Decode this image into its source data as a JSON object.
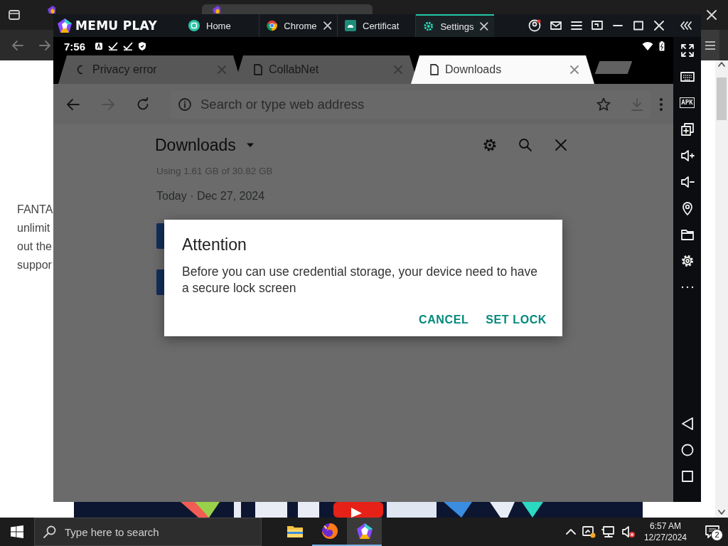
{
  "desktop_browser": {
    "content_lines": [
      "FANTA",
      "unlimit",
      "out the",
      "suppor"
    ]
  },
  "emulator": {
    "logo": "MEMU PLAY",
    "tabs": [
      {
        "label": "Home",
        "kind": "home",
        "selected": false,
        "closable": false
      },
      {
        "label": "Chrome",
        "kind": "chrome",
        "selected": false,
        "closable": true
      },
      {
        "label": "Certificat",
        "kind": "android",
        "selected": false,
        "closable": false
      },
      {
        "label": "Settings",
        "kind": "gear",
        "selected": true,
        "closable": true
      }
    ],
    "status_bar": {
      "time": "7:56"
    },
    "chrome": {
      "tabs": [
        {
          "label": "Privacy error",
          "kind": "loading",
          "selected": false
        },
        {
          "label": "CollabNet",
          "kind": "page",
          "selected": false
        },
        {
          "label": "Downloads",
          "kind": "page",
          "selected": true
        }
      ],
      "address_placeholder": "Search or type web address",
      "page": {
        "title": "Downloads",
        "storage": "Using 1.61 GB of 30.82 GB",
        "date": "Today · Dec 27, 2024",
        "items": [
          {
            "kind": "file"
          },
          {
            "kind": "file"
          }
        ]
      }
    },
    "dialog": {
      "title": "Attention",
      "message": "Before you can use credential storage, your device need to have a secure lock screen",
      "buttons": [
        "CANCEL",
        "SET LOCK"
      ]
    },
    "sidebar": {
      "apk_label": "APK"
    }
  },
  "taskbar": {
    "search_placeholder": "Type here to search",
    "apps": [
      {
        "kind": "folder",
        "open": false,
        "selected": false
      },
      {
        "kind": "browser",
        "open": true,
        "selected": false
      },
      {
        "kind": "emulator",
        "open": true,
        "selected": true
      }
    ],
    "time": "6:57 AM",
    "date": "12/27/2024",
    "notification_count": "2"
  }
}
